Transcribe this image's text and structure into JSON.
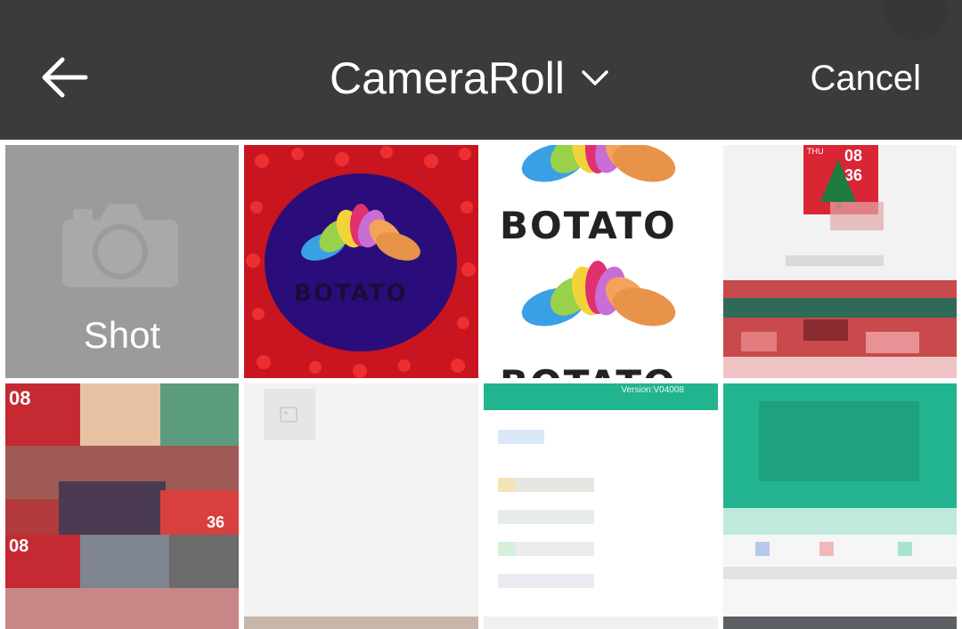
{
  "header": {
    "back_icon": "arrow-left-icon",
    "album_title": "CameraRoll",
    "dropdown_icon": "chevron-down-icon",
    "cancel_label": "Cancel"
  },
  "grid": {
    "shot_label": "Shot",
    "camera_icon": "camera-icon",
    "brand_text": "BOTATO",
    "clock_hour": "08",
    "clock_minute": "36",
    "clock_day": "THU",
    "version_text": "Version:V04008"
  },
  "colors": {
    "header_bg": "#3a3b3d",
    "shot_tile_bg": "#9b9b9b",
    "purple_bg": "#2a0d7a",
    "heart_red": "#d6202b",
    "teal": "#22b48e"
  }
}
